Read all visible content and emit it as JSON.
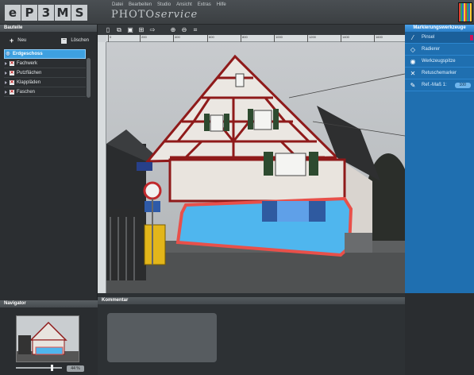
{
  "app": {
    "logo_letters": [
      "e",
      "P",
      "3",
      "M",
      "S"
    ],
    "product_prefix": "PHOTO",
    "product_suffix": "service",
    "menu": [
      "Datei",
      "Bearbeiten",
      "Studio",
      "Ansicht",
      "Extras",
      "Hilfe"
    ]
  },
  "left_panel": {
    "title": "Bauteile",
    "new_label": "Neu",
    "delete_label": "Löschen",
    "items": [
      {
        "label": "Erdgeschoss",
        "selected": true
      },
      {
        "label": "Fachwerk"
      },
      {
        "label": "Putzflächen"
      },
      {
        "label": "Klappläden"
      },
      {
        "label": "Faschen"
      }
    ]
  },
  "navigator": {
    "title": "Navigator",
    "zoom": "44 %"
  },
  "toolbar": {
    "icons": [
      "new-file-icon",
      "open-folder-icon",
      "save-icon",
      "export-image-icon",
      "send-icon",
      "zoom-in-icon",
      "zoom-out-icon",
      "fit-icon"
    ]
  },
  "ruler": {
    "ticks": [
      "0",
      "200",
      "400",
      "600",
      "800",
      "1000",
      "1200",
      "1400",
      "1600"
    ]
  },
  "tools_panel": {
    "title": "Markierungswerkzeuge",
    "tools": [
      {
        "label": "Pinsel",
        "icon": "brush-icon",
        "active": true
      },
      {
        "label": "Radierer",
        "icon": "eraser-icon"
      },
      {
        "label": "Werkzeugspitze",
        "icon": "tool-tip-icon"
      },
      {
        "label": "Retuschemarker",
        "icon": "retouch-marker-icon"
      },
      {
        "label": "Ref.-Maß 1:",
        "icon": "ruler-pen-icon",
        "value": "100"
      }
    ]
  },
  "comment": {
    "title": "Kommentar"
  },
  "photo": {
    "highlight_color": "#4fb6ee",
    "outline_color": "#e8504a",
    "frame_color": "#8f1a1a"
  }
}
